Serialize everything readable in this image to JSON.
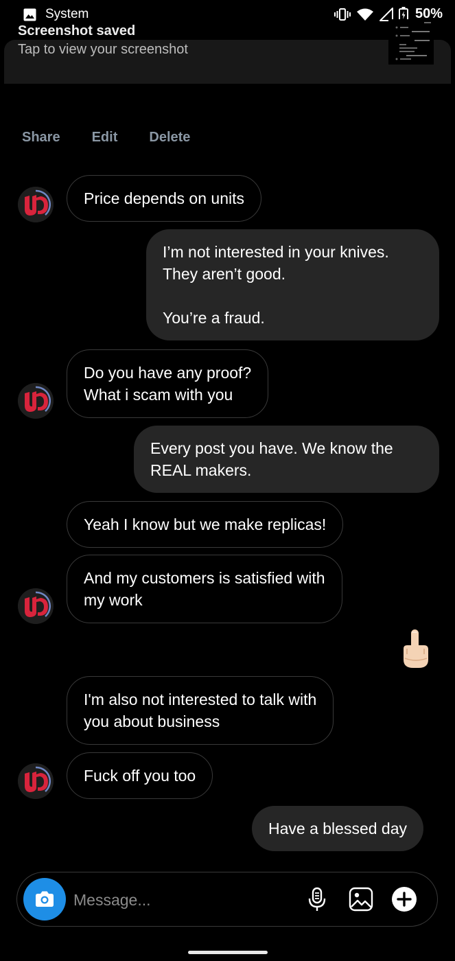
{
  "status_bar": {
    "notification_label": "System",
    "battery": "50%"
  },
  "notification": {
    "title": "Screenshot saved",
    "subtitle": "Tap to view your screenshot",
    "actions": [
      "Share",
      "Edit",
      "Delete"
    ]
  },
  "messages": [
    {
      "from": "them",
      "avatar": true,
      "lines": [
        "Price depends on units"
      ]
    },
    {
      "from": "me",
      "lines": [
        "I’m not interested in your knives.",
        "They aren’t good.",
        "",
        "You’re a fraud."
      ]
    },
    {
      "from": "them",
      "avatar": true,
      "lines": [
        "Do you have any proof?",
        "What i scam with you"
      ]
    },
    {
      "from": "me",
      "lines": [
        "Every post you have. We know the",
        "REAL makers."
      ]
    },
    {
      "from": "them",
      "avatar": false,
      "lines": [
        "Yeah I know but we make replicas!"
      ]
    },
    {
      "from": "them",
      "avatar": true,
      "lines": [
        "And my customers is satisfied with",
        "my work"
      ]
    },
    {
      "from": "me",
      "emoji": "middle-finger-emoji"
    },
    {
      "from": "them",
      "avatar": false,
      "lines": [
        "I'm also not interested to talk with",
        "you about business"
      ]
    },
    {
      "from": "them",
      "avatar": true,
      "lines": [
        "Fuck off you too"
      ]
    },
    {
      "from": "me",
      "lines": [
        "Have a blessed day"
      ]
    }
  ],
  "composer": {
    "placeholder": "Message...",
    "icons": [
      "camera-icon",
      "microphone-icon",
      "gallery-icon",
      "plus-icon"
    ]
  },
  "colors": {
    "background": "#000000",
    "incoming_border": "#3a3a3a",
    "outgoing_bubble": "#262626",
    "camera_button": "#1e8ee6",
    "notification_action": "#8a97a4",
    "avatar_logo": "#d8243c"
  }
}
